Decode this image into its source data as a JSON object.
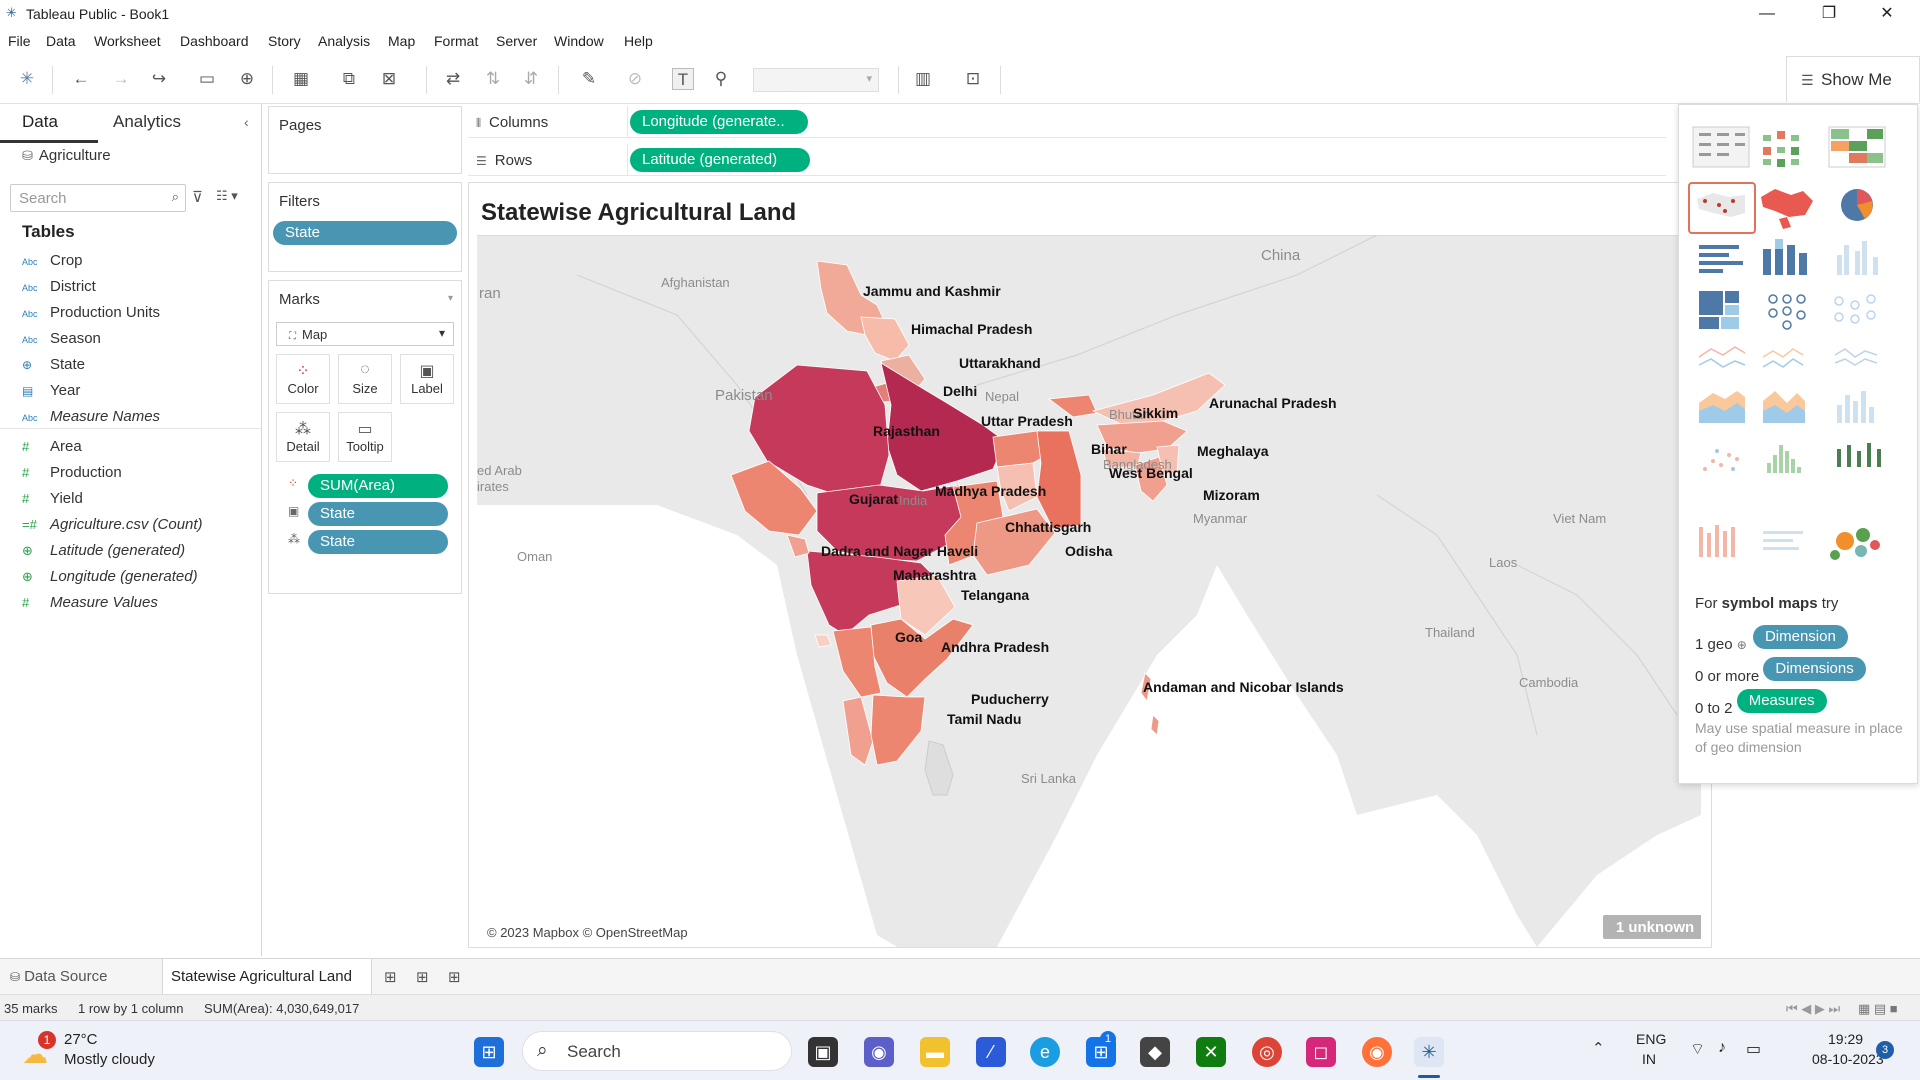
{
  "window": {
    "title": "Tableau Public - Book1",
    "controls": [
      "—",
      "❐",
      "✕"
    ]
  },
  "menu": [
    "File",
    "Data",
    "Worksheet",
    "Dashboard",
    "Story",
    "Analysis",
    "Map",
    "Format",
    "Server",
    "Window",
    "Help"
  ],
  "toolbar": {
    "show_me_label": "Show Me"
  },
  "data_pane": {
    "tabs": {
      "data": "Data",
      "analytics": "Analytics"
    },
    "data_source": "Agriculture",
    "search_placeholder": "Search",
    "tables_heading": "Tables",
    "fields": [
      {
        "type": "Abc",
        "name": "Crop"
      },
      {
        "type": "Abc",
        "name": "District"
      },
      {
        "type": "Abc",
        "name": "Production Units"
      },
      {
        "type": "Abc",
        "name": "Season"
      },
      {
        "type": "geo",
        "name": "State"
      },
      {
        "type": "date",
        "name": "Year"
      },
      {
        "type": "Abc",
        "name": "Measure Names"
      },
      {
        "type": "#",
        "name": "Area"
      },
      {
        "type": "#",
        "name": "Production"
      },
      {
        "type": "#",
        "name": "Yield"
      },
      {
        "type": "=#",
        "name": "Agriculture.csv (Count)"
      },
      {
        "type": "geo",
        "name": "Latitude (generated)"
      },
      {
        "type": "geo",
        "name": "Longitude (generated)"
      },
      {
        "type": "#",
        "name": "Measure Values"
      }
    ]
  },
  "cards": {
    "pages": "Pages",
    "filters": "Filters",
    "filter_pill": "State",
    "marks": "Marks",
    "mark_type": "Map",
    "buttons": [
      "Color",
      "Size",
      "Label",
      "Detail",
      "Tooltip"
    ],
    "mark_pills": [
      "SUM(Area)",
      "State",
      "State"
    ]
  },
  "shelves": {
    "columns_label": "Columns",
    "columns_pill": "Longitude (generate..",
    "rows_label": "Rows",
    "rows_pill": "Latitude (generated)"
  },
  "view": {
    "title": "Statewise Agricultural Land",
    "attribution": "© 2023 Mapbox © OpenStreetMap",
    "unknown_badge": "1 unknown",
    "state_labels": [
      "Jammu and Kashmir",
      "Himachal Pradesh",
      "Uttarakhand",
      "Delhi",
      "Uttar Pradesh",
      "Rajasthan",
      "Sikkim",
      "Arunachal Pradesh",
      "Bihar",
      "Meghalaya",
      "West Bengal",
      "Gujarat",
      "Madhya Pradesh",
      "Mizoram",
      "Chhattisgarh",
      "Dadra and Nagar Haveli",
      "Odisha",
      "Maharashtra",
      "Telangana",
      "Goa",
      "Andhra Pradesh",
      "Andaman and Nicobar Islands",
      "Puducherry",
      "Tamil Nadu"
    ],
    "geo_labels": [
      "China",
      "Afghanistan",
      "ran",
      "Pakistan",
      "Nepal",
      "Bhutan",
      "Bangladesh",
      "ed Arab",
      "irates",
      "India",
      "Myanmar",
      "Viet Nam",
      "Oman",
      "Laos",
      "Thailand",
      "Cambodia",
      "Sri Lanka"
    ],
    "colors": {
      "land": "#e8e8e8",
      "water": "#ffffff",
      "low": "#f6c3b3",
      "high": "#b5234f"
    }
  },
  "show_me": {
    "hint_prefix": "For",
    "hint_bold": "symbol maps",
    "hint_suffix": "try",
    "rows": [
      {
        "count": "1 geo",
        "pill": "Dimension"
      },
      {
        "count": "0 or more",
        "pill": "Dimensions"
      },
      {
        "count": "0 to 2",
        "pill": "Measures"
      }
    ],
    "note": "May use spatial measure in place of geo dimension"
  },
  "sheet_tabs": {
    "data_source": "Data Source",
    "sheet": "Statewise Agricultural Land"
  },
  "status": {
    "marks": "35 marks",
    "grid": "1 row by 1 column",
    "sum": "SUM(Area): 4,030,649,017"
  },
  "taskbar": {
    "weather_temp": "27°C",
    "weather_desc": "Mostly cloudy",
    "weather_badge": "1",
    "search_label": "Search",
    "lang": "ENG",
    "region": "IN",
    "time": "19:29",
    "date": "08-10-2023",
    "notif": "3",
    "store_badge": "1"
  }
}
